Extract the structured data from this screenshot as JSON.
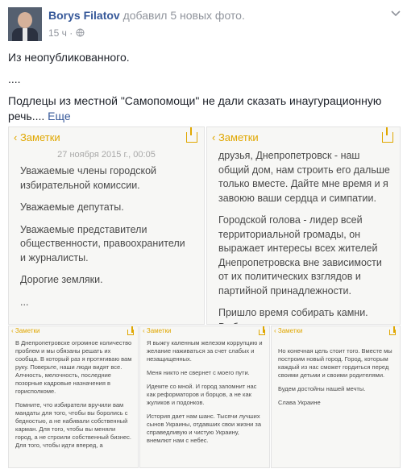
{
  "header": {
    "author": "Borys Filatov",
    "action": "добавил 5 новых фото.",
    "time": "15 ч",
    "separator": "·",
    "audience_icon": "globe-icon",
    "menu_icon": "chevron-down-icon"
  },
  "post": {
    "line1": "Из неопубликованного.",
    "line2": "....",
    "line3": "Подлецы из местной \"Самопомощи\" не дали сказать инаугурационную речь....",
    "more": "Еще"
  },
  "photos": [
    {
      "back_label": "Заметки",
      "date": "27 ноября 2015 г., 00:05",
      "paragraphs": [
        "Уважаемые члены городской избирательной комиссии.",
        "Уважаемые депутаты.",
        "Уважаемые представители общественности, правоохранители и журналисты.",
        "Дорогие земляки.",
        "..."
      ]
    },
    {
      "back_label": "Заметки",
      "paragraphs": [
        "друзья, Днепропетровск - наш общий дом, нам строить его дальше только вместе. Дайте мне время и я завоюю ваши сердца и симпатии.",
        "Городской голова - лидер всей территориальной громады, он выражает интересы всех жителей Днепропетровска вне зависимости от их политических взглядов и партийной принадлежности.",
        "Пришло время собирать камни. Выборы закончились. Сформирован состав"
      ]
    },
    {
      "back_label": "Заметки",
      "paragraphs": [
        "В Днепропетровске огромное количество проблем и мы обязаны решать их сообща. В который раз я протягиваю вам руку. Поверьте, наши люди видят все. Алчность, мелочность, последние позорные кадровые назначения в горисполкоме.",
        "Помните, что избиратели вручили вам мандаты для того, чтобы вы боролись с бедностью, а не набивали собственный карман. Для того, чтобы вы меняли город, а не строили собственный бизнес. Для того, чтобы идти вперед, а"
      ]
    },
    {
      "back_label": "Заметки",
      "paragraphs": [
        "Я выжгу каленным железом коррупцию и желание наживаться за счет слабых и незащищенных.",
        "Меня никто не свернет с моего пути.",
        "Идемте со мной. И город запомнит нас как реформаторов и борцов, а не как жуликов и подонков.",
        "История дает нам шанс. Тысячи лучших сынов Украины, отдавших свои жизни за справедливую и чистую Украину, внемлют нам с небес."
      ]
    },
    {
      "back_label": "Заметки",
      "paragraphs": [
        "Но конечная цель стоит того. Вместе мы построим новый город. Город, которым каждый из нас сможет гордиться перед своими детьми и своими родителями.",
        "Будем достойны нашей мечты.",
        "Слава Украине"
      ]
    }
  ]
}
